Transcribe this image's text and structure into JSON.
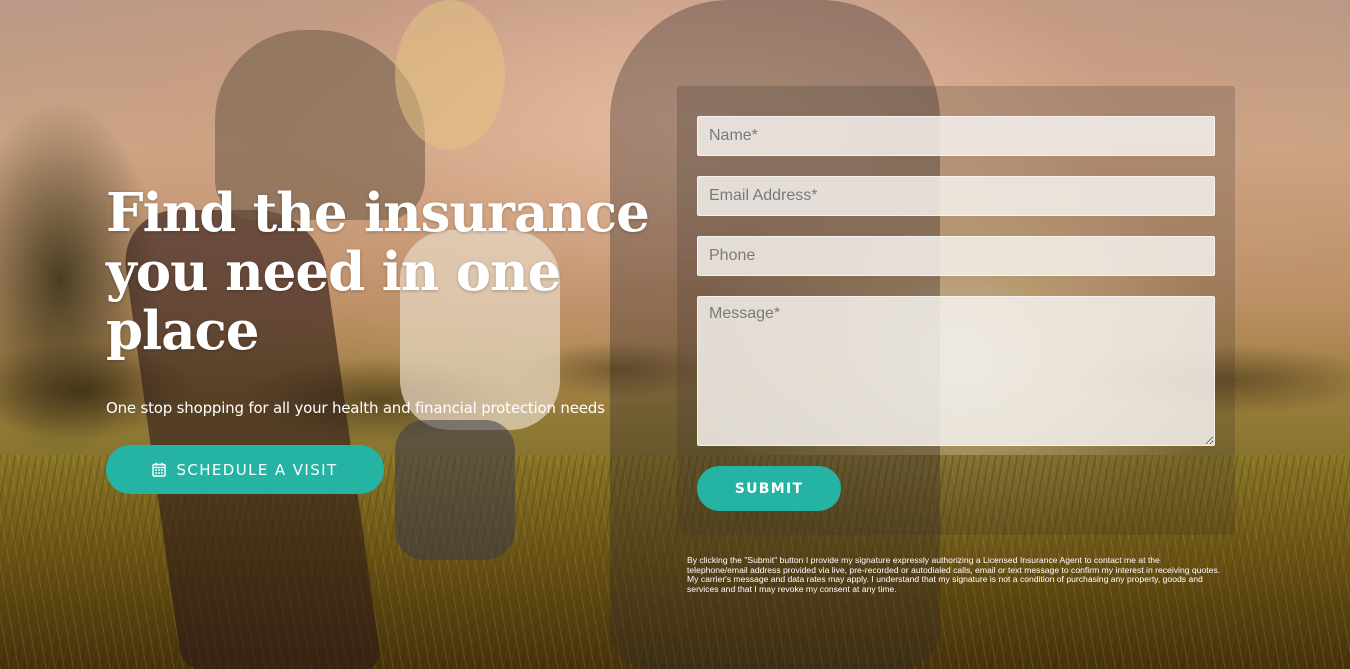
{
  "hero": {
    "headline": "Find the insurance you need in one place",
    "tagline": "One stop shopping for all your health and financial protection needs",
    "schedule_button": {
      "label": "SCHEDULE A VISIT",
      "icon": "calendar-icon"
    }
  },
  "form": {
    "name_placeholder": "Name*",
    "email_placeholder": "Email Address*",
    "phone_placeholder": "Phone",
    "message_placeholder": "Message*",
    "submit_label": "SUBMIT",
    "disclaimer": "By clicking the \"Submit\" button I provide my signature expressly authorizing a Licensed Insurance Agent to contact me at the telephone/email address provided via live, pre-recorded or autodialed calls, email or text message to confirm my interest in receiving quotes. My carrier's message and data rates may apply. I understand that my signature is not a condition of purchasing any property, goods and services and that I may revoke my consent at any time."
  },
  "colors": {
    "accent": "#25b3a3",
    "text": "#ffffff"
  }
}
